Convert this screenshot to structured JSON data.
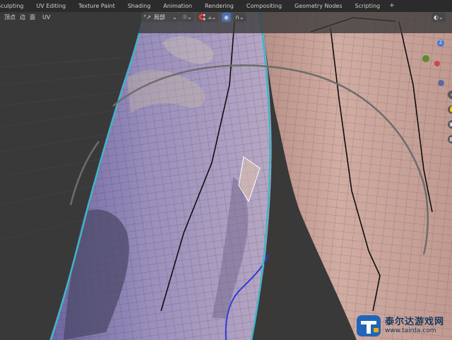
{
  "workspaces": [
    "Sculpting",
    "UV Editing",
    "Texture Paint",
    "Shading",
    "Animation",
    "Rendering",
    "Compositing",
    "Geometry Nodes",
    "Scripting"
  ],
  "add_workspace": "+",
  "select_modes": [
    "顶点",
    "边",
    "面"
  ],
  "uv_menu": "UV",
  "header": {
    "transform_orientation": "局部",
    "dropdown_glyph": "⌄"
  },
  "gizmo": {
    "z_label": "Z"
  },
  "watermark": {
    "brand": "泰尔达游戏网",
    "url": "www.tairda.com"
  },
  "colors": {
    "topbar": "#2b2b2b",
    "viewport_bg": "#393939",
    "selection_outline": "#3fb6c8",
    "skin": "#c9a39a",
    "fabric": "#8478a8",
    "accent_blue": "#4772b3"
  },
  "icons": [
    "snap-icon",
    "proportional-icon",
    "overlay-icon",
    "gizmo-icon",
    "pivot-icon",
    "falloff-icon",
    "zoom-icon",
    "hand-icon",
    "camera-icon",
    "grid-icon"
  ]
}
